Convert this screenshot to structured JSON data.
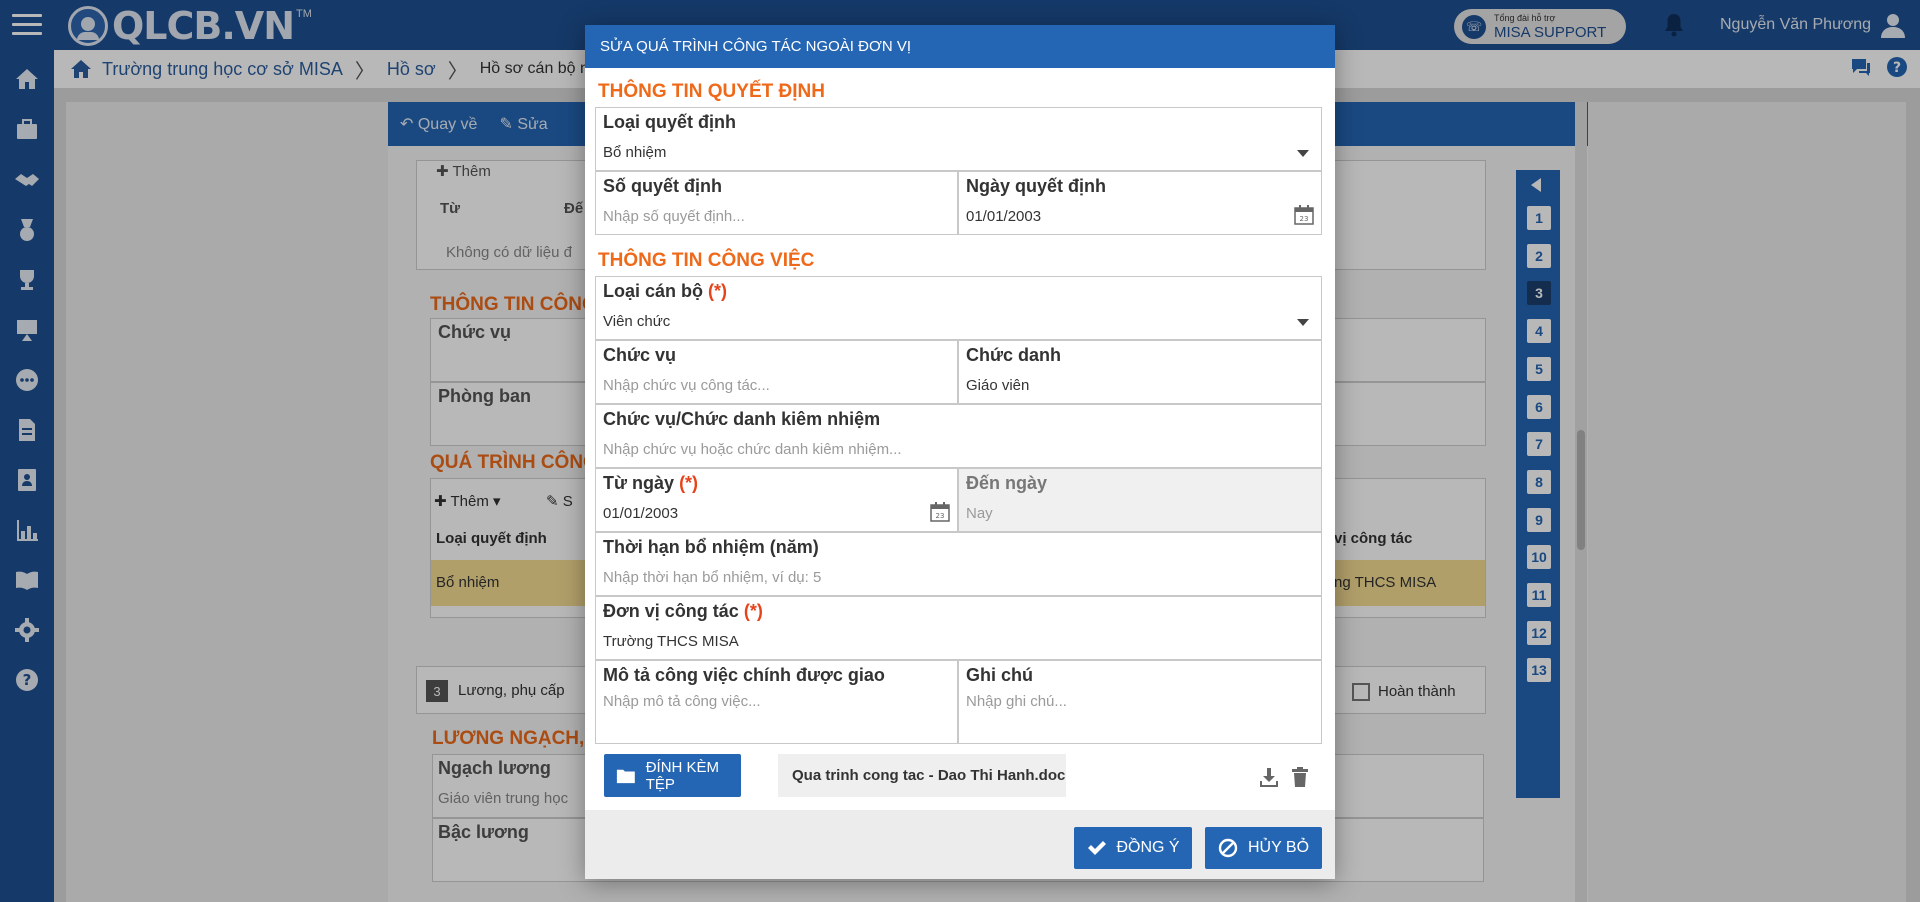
{
  "app": {
    "logo_text": "QLCB.VN",
    "logo_tm": "TM"
  },
  "header": {
    "support_small": "Tổng đài hỗ trợ",
    "support_big": "MISA SUPPORT",
    "user_name": "Nguyễn Văn Phương"
  },
  "breadcrumb": {
    "items": [
      "Trường trung học cơ sở MISA",
      "Hồ sơ",
      "Hồ sơ cán bộ nhân v"
    ]
  },
  "background": {
    "toolbar": {
      "back": "Quay về",
      "edit": "Sửa"
    },
    "sub_toolbar": {
      "add": "Thêm",
      "edit": "Sửa"
    },
    "table1_cols": [
      "Từ",
      "Đế"
    ],
    "table1_empty": "Không có dữ liệu đ",
    "section_info": "THÔNG TIN CÔNG",
    "label_position": "Chức vụ",
    "label_department": "Phòng ban",
    "section_process": "QUÁ TRÌNH CÔNG",
    "process_add": "Thêm",
    "process_edit": "S",
    "process_col1": "Loại quyết định",
    "process_col_right": "vị công tác",
    "process_row_col1": "Bổ nhiệm",
    "process_row_right": "ng THCS MISA",
    "section3_num": "3",
    "section3_title": "Lương, phụ cấp",
    "complete_label": "Hoàn thành",
    "salary_title": "LƯƠNG NGẠCH, B",
    "salary_grade_label": "Ngạch lương",
    "salary_grade_value": "Giáo viên trung học",
    "salary_level_label": "Bậc lương",
    "nav_numbers": [
      "1",
      "2",
      "3",
      "4",
      "5",
      "6",
      "7",
      "8",
      "9",
      "10",
      "11",
      "12",
      "13"
    ],
    "nav_active": "3"
  },
  "dialog": {
    "title": "SỬA QUÁ TRÌNH CÔNG TÁC NGOÀI ĐƠN VỊ",
    "section_decision": "THÔNG TIN QUYẾT ĐỊNH",
    "decision_type": {
      "label": "Loại quyết định",
      "value": "Bổ nhiệm"
    },
    "decision_number": {
      "label": "Số quyết định",
      "placeholder": "Nhập số quyết định..."
    },
    "decision_date": {
      "label": "Ngày quyết định",
      "value": "01/01/2003"
    },
    "section_job": "THÔNG TIN CÔNG VIỆC",
    "staff_type": {
      "label": "Loại cán bộ",
      "required": "(*)",
      "value": "Viên chức"
    },
    "position": {
      "label": "Chức vụ",
      "placeholder": "Nhập chức vụ công tác..."
    },
    "title_field": {
      "label": "Chức danh",
      "value": "Giáo viên"
    },
    "concurrent": {
      "label": "Chức vụ/Chức danh kiêm nhiệm",
      "placeholder": "Nhập chức vụ hoặc chức danh kiêm nhiệm..."
    },
    "from_date": {
      "label": "Từ ngày",
      "required": "(*)",
      "value": "01/01/2003"
    },
    "to_date": {
      "label": "Đến ngày",
      "value": "Nay"
    },
    "term": {
      "label": "Thời hạn bổ nhiệm (năm)",
      "placeholder": "Nhập thời hạn bổ nhiệm, ví dụ: 5"
    },
    "unit": {
      "label": "Đơn vị công tác",
      "required": "(*)",
      "value": "Trường THCS MISA"
    },
    "job_desc": {
      "label": "Mô tả công việc chính được giao",
      "placeholder": "Nhập mô tả công việc..."
    },
    "note": {
      "label": "Ghi chú",
      "placeholder": "Nhập ghi chú..."
    },
    "attach_label": "ĐÍNH KÈM TỆP",
    "attached_file": "Qua trinh cong tac - Dao Thi Hanh.doc",
    "ok_label": "ĐỒNG Ý",
    "cancel_label": "HỦY BỎ"
  },
  "colors": {
    "primary": "#2466b4",
    "header": "#1e4f90",
    "accent": "#ee6a1a",
    "required": "#e6431b"
  }
}
